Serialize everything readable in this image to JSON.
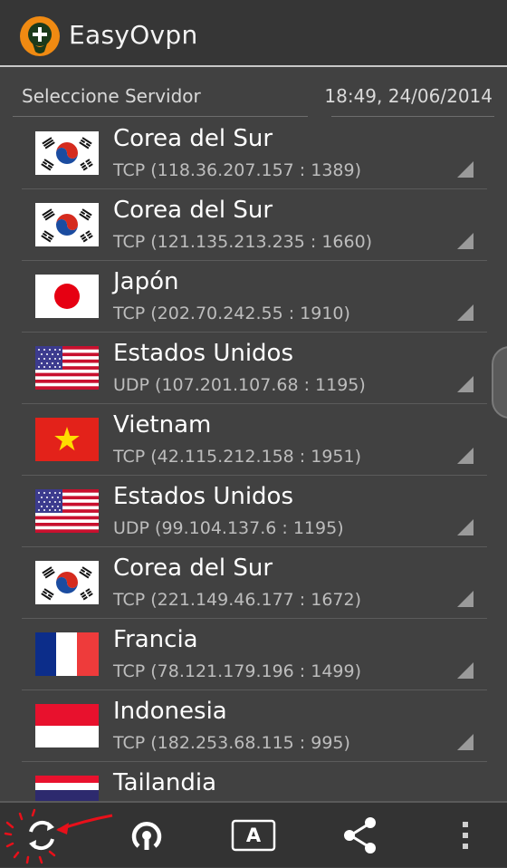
{
  "app": {
    "title": "EasyOvpn",
    "icon": "easyovpn-logo-icon"
  },
  "header": {
    "select_label": "Seleccione Servidor",
    "datetime": "18:49, 24/06/2014"
  },
  "servers": [
    {
      "country": "Corea del Sur",
      "flag": "south-korea-flag-icon",
      "protocol": "TCP (118.36.207.157 : 1389)"
    },
    {
      "country": "Corea del Sur",
      "flag": "south-korea-flag-icon",
      "protocol": "TCP (121.135.213.235 : 1660)"
    },
    {
      "country": "Japón",
      "flag": "japan-flag-icon",
      "protocol": "TCP (202.70.242.55 : 1910)"
    },
    {
      "country": "Estados Unidos",
      "flag": "usa-flag-icon",
      "protocol": "UDP (107.201.107.68 : 1195)"
    },
    {
      "country": "Vietnam",
      "flag": "vietnam-flag-icon",
      "protocol": "TCP (42.115.212.158 : 1951)"
    },
    {
      "country": "Estados Unidos",
      "flag": "usa-flag-icon",
      "protocol": "UDP (99.104.137.6 : 1195)"
    },
    {
      "country": "Corea del Sur",
      "flag": "south-korea-flag-icon",
      "protocol": "TCP (221.149.46.177 : 1672)"
    },
    {
      "country": "Francia",
      "flag": "france-flag-icon",
      "protocol": "TCP (78.121.179.196 : 1499)"
    },
    {
      "country": "Indonesia",
      "flag": "indonesia-flag-icon",
      "protocol": "TCP (182.253.68.115 : 995)"
    },
    {
      "country": "Tailandia",
      "flag": "thailand-flag-icon",
      "protocol": ""
    }
  ],
  "bottom_bar": {
    "refresh_icon": "refresh-icon",
    "connect_icon": "vpn-connect-icon",
    "font_button_label": "A",
    "share_icon": "share-icon",
    "overflow_icon": "more-vertical-icon"
  },
  "colors": {
    "background": "#414141",
    "action_bar": "#363636",
    "bottom_bar": "#333333",
    "annotation_red": "#e8101a"
  }
}
